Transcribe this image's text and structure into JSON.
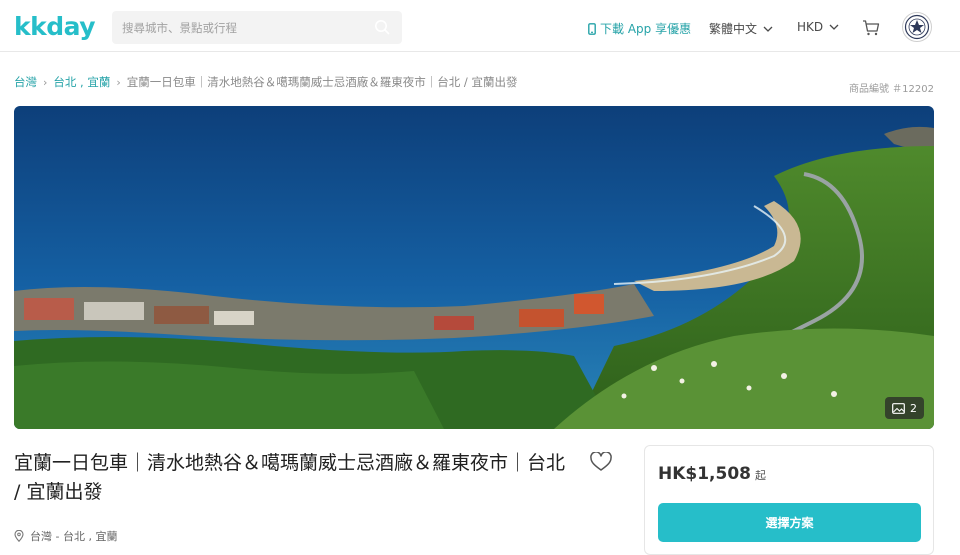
{
  "header": {
    "logo": "kkday",
    "search_placeholder": "搜尋城市、景點或行程",
    "app_download": "下載 App 享優惠",
    "language": "繁體中文",
    "currency": "HKD"
  },
  "breadcrumb": {
    "items": [
      "台灣",
      "台北 , 宜蘭"
    ],
    "current": "宜蘭一日包車｜清水地熱谷＆噶瑪蘭威士忌酒廠＆羅東夜市｜台北 / 宜蘭出發"
  },
  "product_code": "商品編號 ＃12202",
  "hero": {
    "photo_count": "2"
  },
  "product": {
    "title": "宜蘭一日包車｜清水地熱谷＆噶瑪蘭威士忌酒廠＆羅東夜市｜台北 / 宜蘭出發",
    "location": "台灣 - 台北 , 宜蘭"
  },
  "pricing": {
    "price": "HK$1,508",
    "price_suffix": "起",
    "select_button": "選擇方案"
  },
  "colors": {
    "brand": "#26bec9",
    "link": "#26a3a8"
  }
}
